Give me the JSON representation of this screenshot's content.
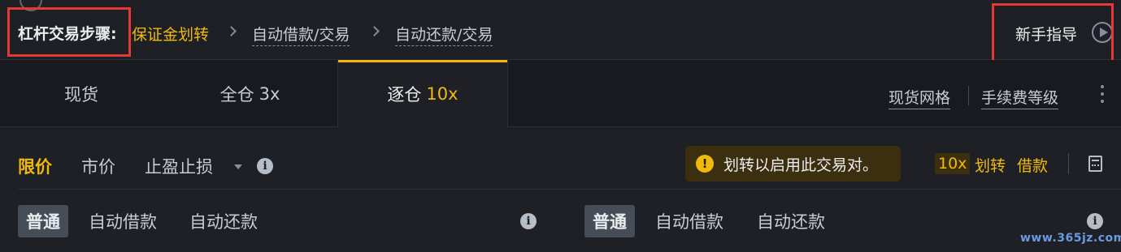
{
  "steps": {
    "label": "杠杆交易步骤:",
    "items": [
      "保证金划转",
      "自动借款/交易",
      "自动还款/交易"
    ]
  },
  "guide": {
    "label": "新手指导",
    "icon": "play-circle-icon"
  },
  "margin_tabs": [
    {
      "label": "现货",
      "leverage": ""
    },
    {
      "label": "全仓",
      "leverage": "3x"
    },
    {
      "label": "逐仓",
      "leverage": "10x"
    }
  ],
  "active_margin_tab": "逐仓",
  "right_links": {
    "spot_grid": "现货网格",
    "fee_level": "手续费等级",
    "more_icon": "kebab-icon"
  },
  "order_types": {
    "limit": "限价",
    "market": "市价",
    "stop": "止盈止损",
    "info_icon": "info-icon"
  },
  "notice": {
    "icon": "warning-icon",
    "text": "划转以启用此交易对。"
  },
  "actions": {
    "leverage": "10x",
    "transfer": "划转",
    "borrow": "借款",
    "calc_icon": "calculator-icon"
  },
  "buy_modes": [
    "普通",
    "自动借款",
    "自动还款"
  ],
  "sell_modes": [
    "普通",
    "自动借款",
    "自动还款"
  ],
  "watermark": "www.365jz.com",
  "colors": {
    "accent": "#f0b90b",
    "background": "#181a20",
    "panel": "#1e2026",
    "highlight_box": "#e53935"
  }
}
